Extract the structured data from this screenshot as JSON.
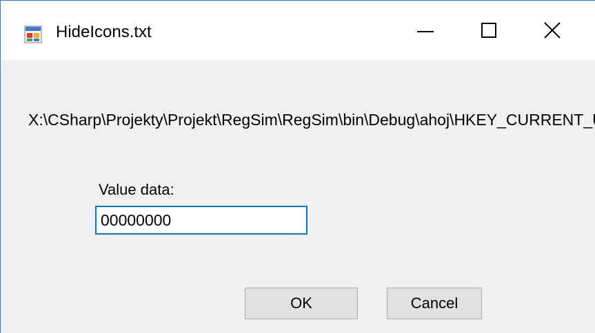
{
  "window": {
    "title": "HideIcons.txt",
    "app_icon": "form-window-icon",
    "controls": {
      "minimize_icon": "minimize-icon",
      "maximize_icon": "maximize-icon",
      "close_icon": "close-icon"
    }
  },
  "dialog": {
    "path": "X:\\CSharp\\Projekty\\Projekt\\RegSim\\RegSim\\bin\\Debug\\ahoj\\HKEY_CURRENT_USER",
    "value_label": "Value data:",
    "value": "00000000",
    "ok_label": "OK",
    "cancel_label": "Cancel"
  },
  "colors": {
    "accent": "#0078d7",
    "window_border": "#2b7fd1",
    "button_face": "#e1e1e1",
    "background": "#f0f0f0"
  }
}
